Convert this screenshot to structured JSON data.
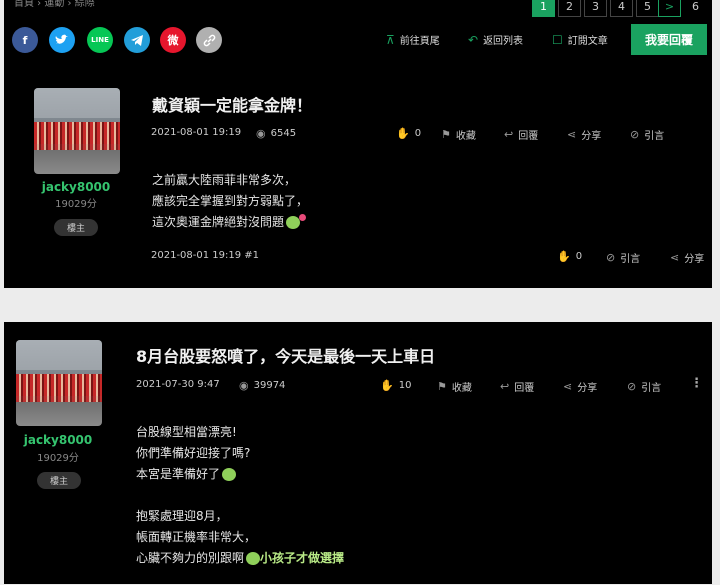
{
  "breadcrumb": {
    "text": "首頁 › 運動 › 綜際"
  },
  "share": {
    "facebook": "f",
    "line": "LINE",
    "weibo": "微"
  },
  "toolbar": {
    "go_bottom": "前往頁尾",
    "back_list": "返回列表",
    "subscribe": "訂閱文章",
    "reply": "我要回覆"
  },
  "pagination": {
    "pages": [
      "1",
      "2",
      "3",
      "4",
      "5",
      "6"
    ],
    "current": "1",
    "next_symbol": ">"
  },
  "posts": [
    {
      "author": "jacky8000",
      "points": "19029分",
      "role": "樓主",
      "title": "戴資穎一定能拿金牌！",
      "date": "2021-08-01 19:19",
      "views": "6545",
      "likes": "0",
      "collect": "收藏",
      "reply": "回覆",
      "share": "分享",
      "quote": "引言",
      "lines": [
        "之前贏大陸雨菲非常多次，",
        "應該完全掌握到對方弱點了，",
        "這次奧運金牌絕對沒問題"
      ],
      "footer_date": "2021-08-01 19:19 #1",
      "footer_likes": "0",
      "footer_quote": "引言",
      "footer_share": "分享"
    },
    {
      "author": "jacky8000",
      "points": "19029分",
      "role": "樓主",
      "title": "8月台股要怒噴了，今天是最後一天上車日",
      "date": "2021-07-30 9:47",
      "views": "39974",
      "likes": "10",
      "collect": "收藏",
      "reply": "回覆",
      "share": "分享",
      "quote": "引言",
      "lines": [
        "台股線型相當漂亮!",
        "你們準備好迎接了嗎?",
        "本宮是準備好了",
        "",
        "抱緊處理迎8月，",
        "帳面轉正機率非常大，",
        "心臟不夠力的別跟啊"
      ],
      "tag": "小孩子才做選擇"
    }
  ],
  "colors": {
    "accent": "#1aa260",
    "username": "#35c46f",
    "background": "#000000"
  }
}
